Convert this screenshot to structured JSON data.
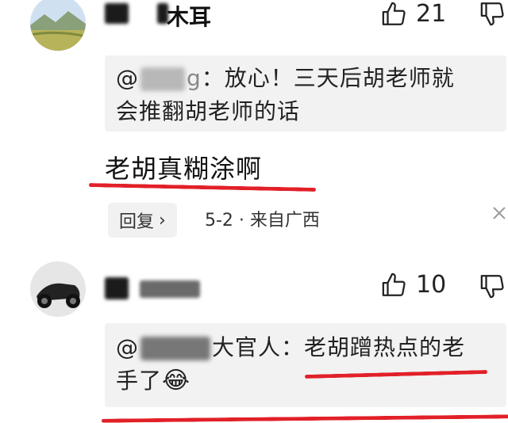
{
  "comment1": {
    "name_suffix": "木耳",
    "likes": "21",
    "quote_at": "@",
    "quote_mask_tail": "g",
    "quote_text_line1": "：放心！三天后胡老师就",
    "quote_text_line2": "会推翻胡老师的话",
    "body": "老胡真糊涂啊",
    "reply_label": "回复",
    "reply_arrow": "›",
    "meta": "5-2 · 来自广西"
  },
  "comment2": {
    "likes": "10",
    "quote_at": "@",
    "quote_name_visible": "大官人：",
    "quote_text_part1": "老胡蹭热点的老",
    "quote_text_line2": "手了",
    "emoji": "😂"
  },
  "colors": {
    "underline": "#e22028",
    "quote_bg": "#f2f2f2"
  }
}
